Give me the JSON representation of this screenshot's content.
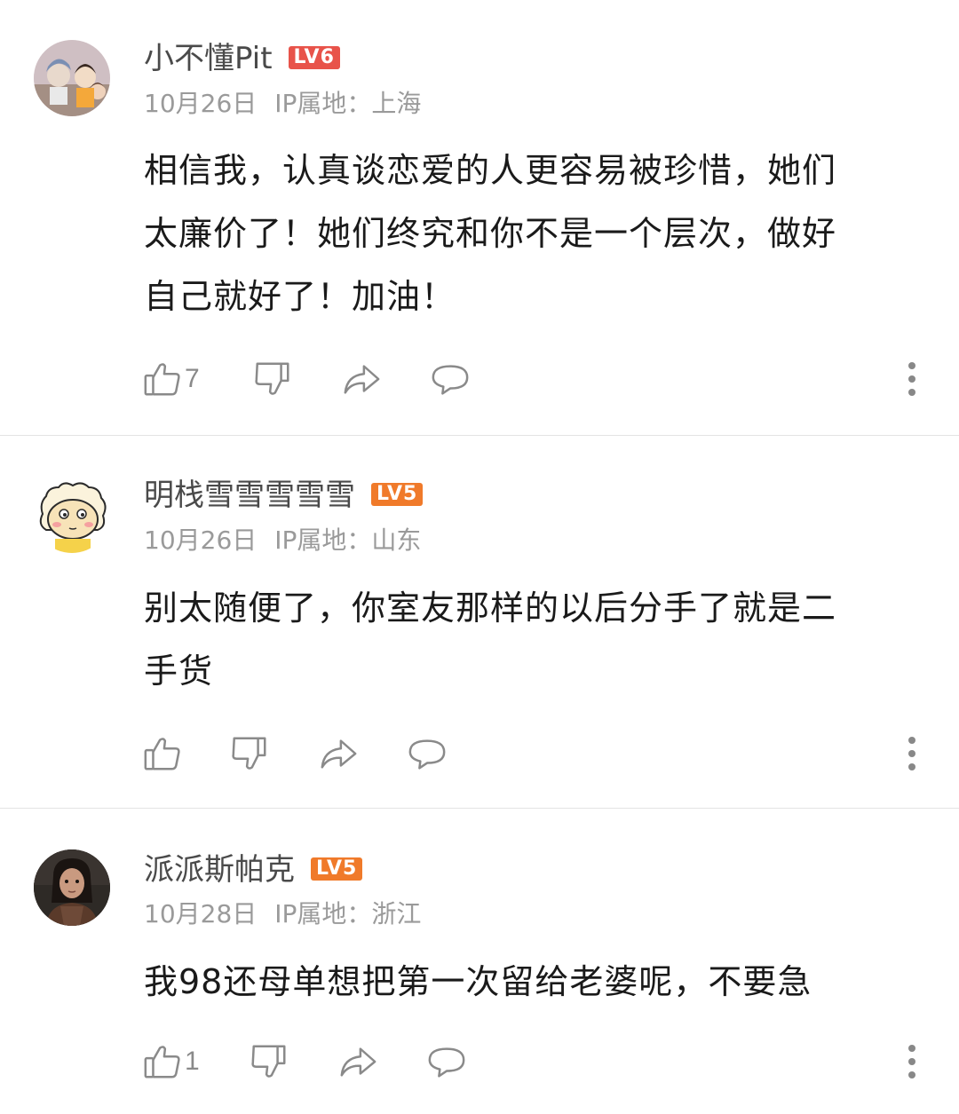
{
  "comments": [
    {
      "username": "小不懂Pit",
      "level": "LV6",
      "level_color": "#e8534a",
      "date": "10月26日",
      "ip_label": "IP属地：",
      "ip_location": "上海",
      "lines": [
        "相信我，认真谈恋爱的人更容易被珍惜，她们",
        "太廉价了！她们终究和你不是一个层次，做好",
        "自己就好了！加油！"
      ],
      "like_count": "7",
      "avatar_icon": "anime-group-avatar"
    },
    {
      "username": "明栈雪雪雪雪雪",
      "level": "LV5",
      "level_color": "#f07a2a",
      "date": "10月26日",
      "ip_label": "IP属地：",
      "ip_location": "山东",
      "lines": [
        "别太随便了，你室友那样的以后分手了就是二",
        "手货"
      ],
      "like_count": "",
      "avatar_icon": "cartoon-sheep-avatar"
    },
    {
      "username": "派派斯帕克",
      "level": "LV5",
      "level_color": "#f07a2a",
      "date": "10月28日",
      "ip_label": "IP属地：",
      "ip_location": "浙江",
      "lines": [
        "我98还母单想把第一次留给老婆呢，不要急"
      ],
      "like_count": "1",
      "avatar_icon": "portrait-photo-avatar"
    }
  ],
  "icons": {
    "like": "thumbs-up-icon",
    "dislike": "thumbs-down-icon",
    "share": "share-arrow-icon",
    "reply": "comment-bubble-icon",
    "more": "more-vertical-icon"
  }
}
